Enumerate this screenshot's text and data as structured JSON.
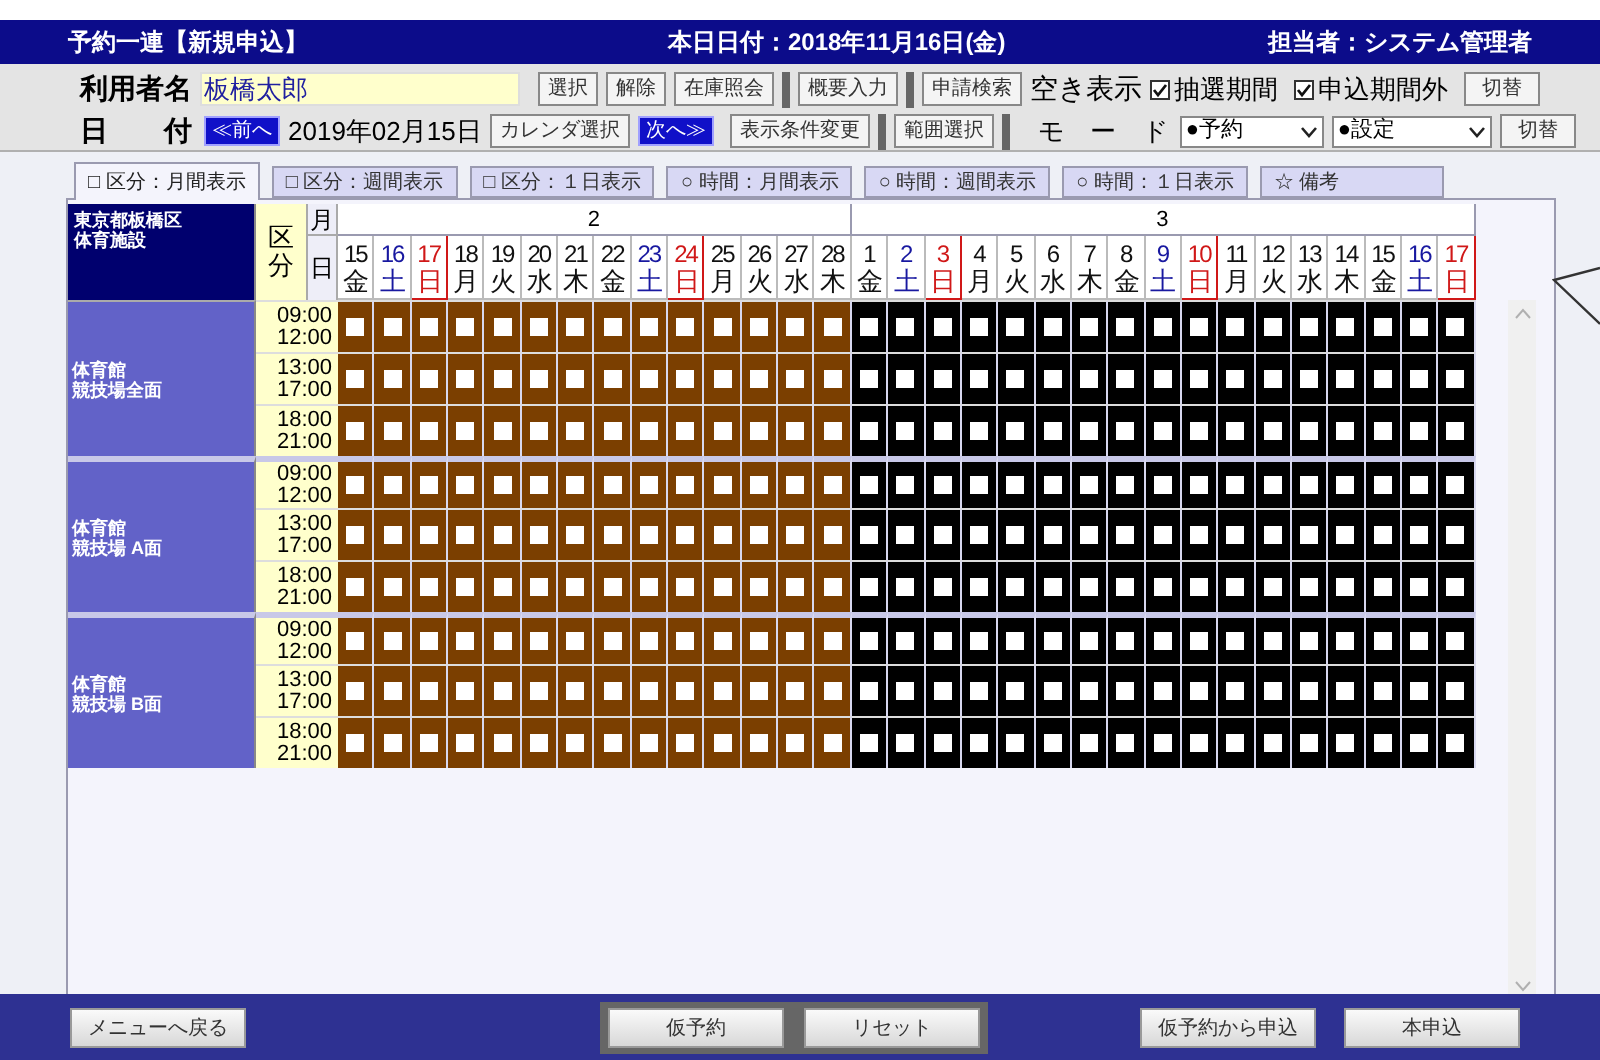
{
  "title_bar": {
    "title": "予約一連【新規申込】",
    "today": "本日日付：2018年11月16日(金)",
    "operator": "担当者：システム管理者"
  },
  "user_row": {
    "label": "利用者名",
    "value": "板橋太郎",
    "buttons": [
      "選択",
      "解除",
      "在庫照会"
    ],
    "buttons_2": [
      "概要入力"
    ],
    "search_button": "申請検索",
    "vacancy_label": "空き表示",
    "checkboxes": [
      {
        "label": "抽選期間",
        "checked": true
      },
      {
        "label": "申込期間外",
        "checked": true
      }
    ],
    "switch_button": "切替"
  },
  "date_row": {
    "label": "日　　付",
    "prev": "≪前へ",
    "date": "2019年02月15日",
    "calendar_button": "カレンダ選択",
    "next": "次へ≫",
    "condition_button": "表示条件変更",
    "range_button": "範囲選択",
    "mode_label": "モ　ー　ド",
    "selects": [
      "●予約",
      "●設定"
    ],
    "switch_button": "切替"
  },
  "tabs": [
    {
      "label": "□ 区分：月間表示",
      "selected": true
    },
    {
      "label": "□ 区分：週間表示",
      "selected": false
    },
    {
      "label": "□ 区分：１日表示",
      "selected": false
    },
    {
      "label": "○ 時間：月間表示",
      "selected": false
    },
    {
      "label": "○ 時間：週間表示",
      "selected": false
    },
    {
      "label": "○ 時間：１日表示",
      "selected": false
    },
    {
      "label": "☆ 備考",
      "selected": false
    }
  ],
  "grid": {
    "facility_header": [
      "東京都板橋区",
      "体育施設"
    ],
    "division_header": "区分",
    "month_header": "月",
    "day_header": "日",
    "months": [
      {
        "label": "2",
        "color": "#7b3f00",
        "days": [
          {
            "date": "15",
            "weekday": "金",
            "kind": "weekday"
          },
          {
            "date": "16",
            "weekday": "土",
            "kind": "saturday"
          },
          {
            "date": "17",
            "weekday": "日",
            "kind": "sunday"
          },
          {
            "date": "18",
            "weekday": "月",
            "kind": "weekday"
          },
          {
            "date": "19",
            "weekday": "火",
            "kind": "weekday"
          },
          {
            "date": "20",
            "weekday": "水",
            "kind": "weekday"
          },
          {
            "date": "21",
            "weekday": "木",
            "kind": "weekday"
          },
          {
            "date": "22",
            "weekday": "金",
            "kind": "weekday"
          },
          {
            "date": "23",
            "weekday": "土",
            "kind": "saturday"
          },
          {
            "date": "24",
            "weekday": "日",
            "kind": "sunday"
          },
          {
            "date": "25",
            "weekday": "月",
            "kind": "weekday"
          },
          {
            "date": "26",
            "weekday": "火",
            "kind": "weekday"
          },
          {
            "date": "27",
            "weekday": "水",
            "kind": "weekday"
          },
          {
            "date": "28",
            "weekday": "木",
            "kind": "weekday"
          }
        ]
      },
      {
        "label": "3",
        "color": "#000000",
        "days": [
          {
            "date": "1",
            "weekday": "金",
            "kind": "weekday"
          },
          {
            "date": "2",
            "weekday": "土",
            "kind": "saturday"
          },
          {
            "date": "3",
            "weekday": "日",
            "kind": "sunday"
          },
          {
            "date": "4",
            "weekday": "月",
            "kind": "weekday"
          },
          {
            "date": "5",
            "weekday": "火",
            "kind": "weekday"
          },
          {
            "date": "6",
            "weekday": "水",
            "kind": "weekday"
          },
          {
            "date": "7",
            "weekday": "木",
            "kind": "weekday"
          },
          {
            "date": "8",
            "weekday": "金",
            "kind": "weekday"
          },
          {
            "date": "9",
            "weekday": "土",
            "kind": "saturday"
          },
          {
            "date": "10",
            "weekday": "日",
            "kind": "sunday"
          },
          {
            "date": "11",
            "weekday": "月",
            "kind": "weekday"
          },
          {
            "date": "12",
            "weekday": "火",
            "kind": "weekday"
          },
          {
            "date": "13",
            "weekday": "水",
            "kind": "weekday"
          },
          {
            "date": "14",
            "weekday": "木",
            "kind": "weekday"
          },
          {
            "date": "15",
            "weekday": "金",
            "kind": "weekday"
          },
          {
            "date": "16",
            "weekday": "土",
            "kind": "saturday"
          },
          {
            "date": "17",
            "weekday": "日",
            "kind": "sunday"
          }
        ]
      }
    ],
    "facilities": [
      {
        "name": [
          "体育館",
          "競技場全面"
        ],
        "slots": [
          [
            "09:00",
            "12:00"
          ],
          [
            "13:00",
            "17:00"
          ],
          [
            "18:00",
            "21:00"
          ]
        ]
      },
      {
        "name": [
          "体育館",
          "競技場 A面"
        ],
        "slots": [
          [
            "09:00",
            "12:00"
          ],
          [
            "13:00",
            "17:00"
          ],
          [
            "18:00",
            "21:00"
          ]
        ]
      },
      {
        "name": [
          "体育館",
          "競技場 B面"
        ],
        "slots": [
          [
            "09:00",
            "12:00"
          ],
          [
            "13:00",
            "17:00"
          ],
          [
            "18:00",
            "21:00"
          ]
        ]
      }
    ]
  },
  "footer": {
    "back_button": "メニューへ戻る",
    "group_buttons": [
      "仮予約",
      "リセット"
    ],
    "right_buttons": [
      "仮予約から申込",
      "本申込"
    ]
  }
}
